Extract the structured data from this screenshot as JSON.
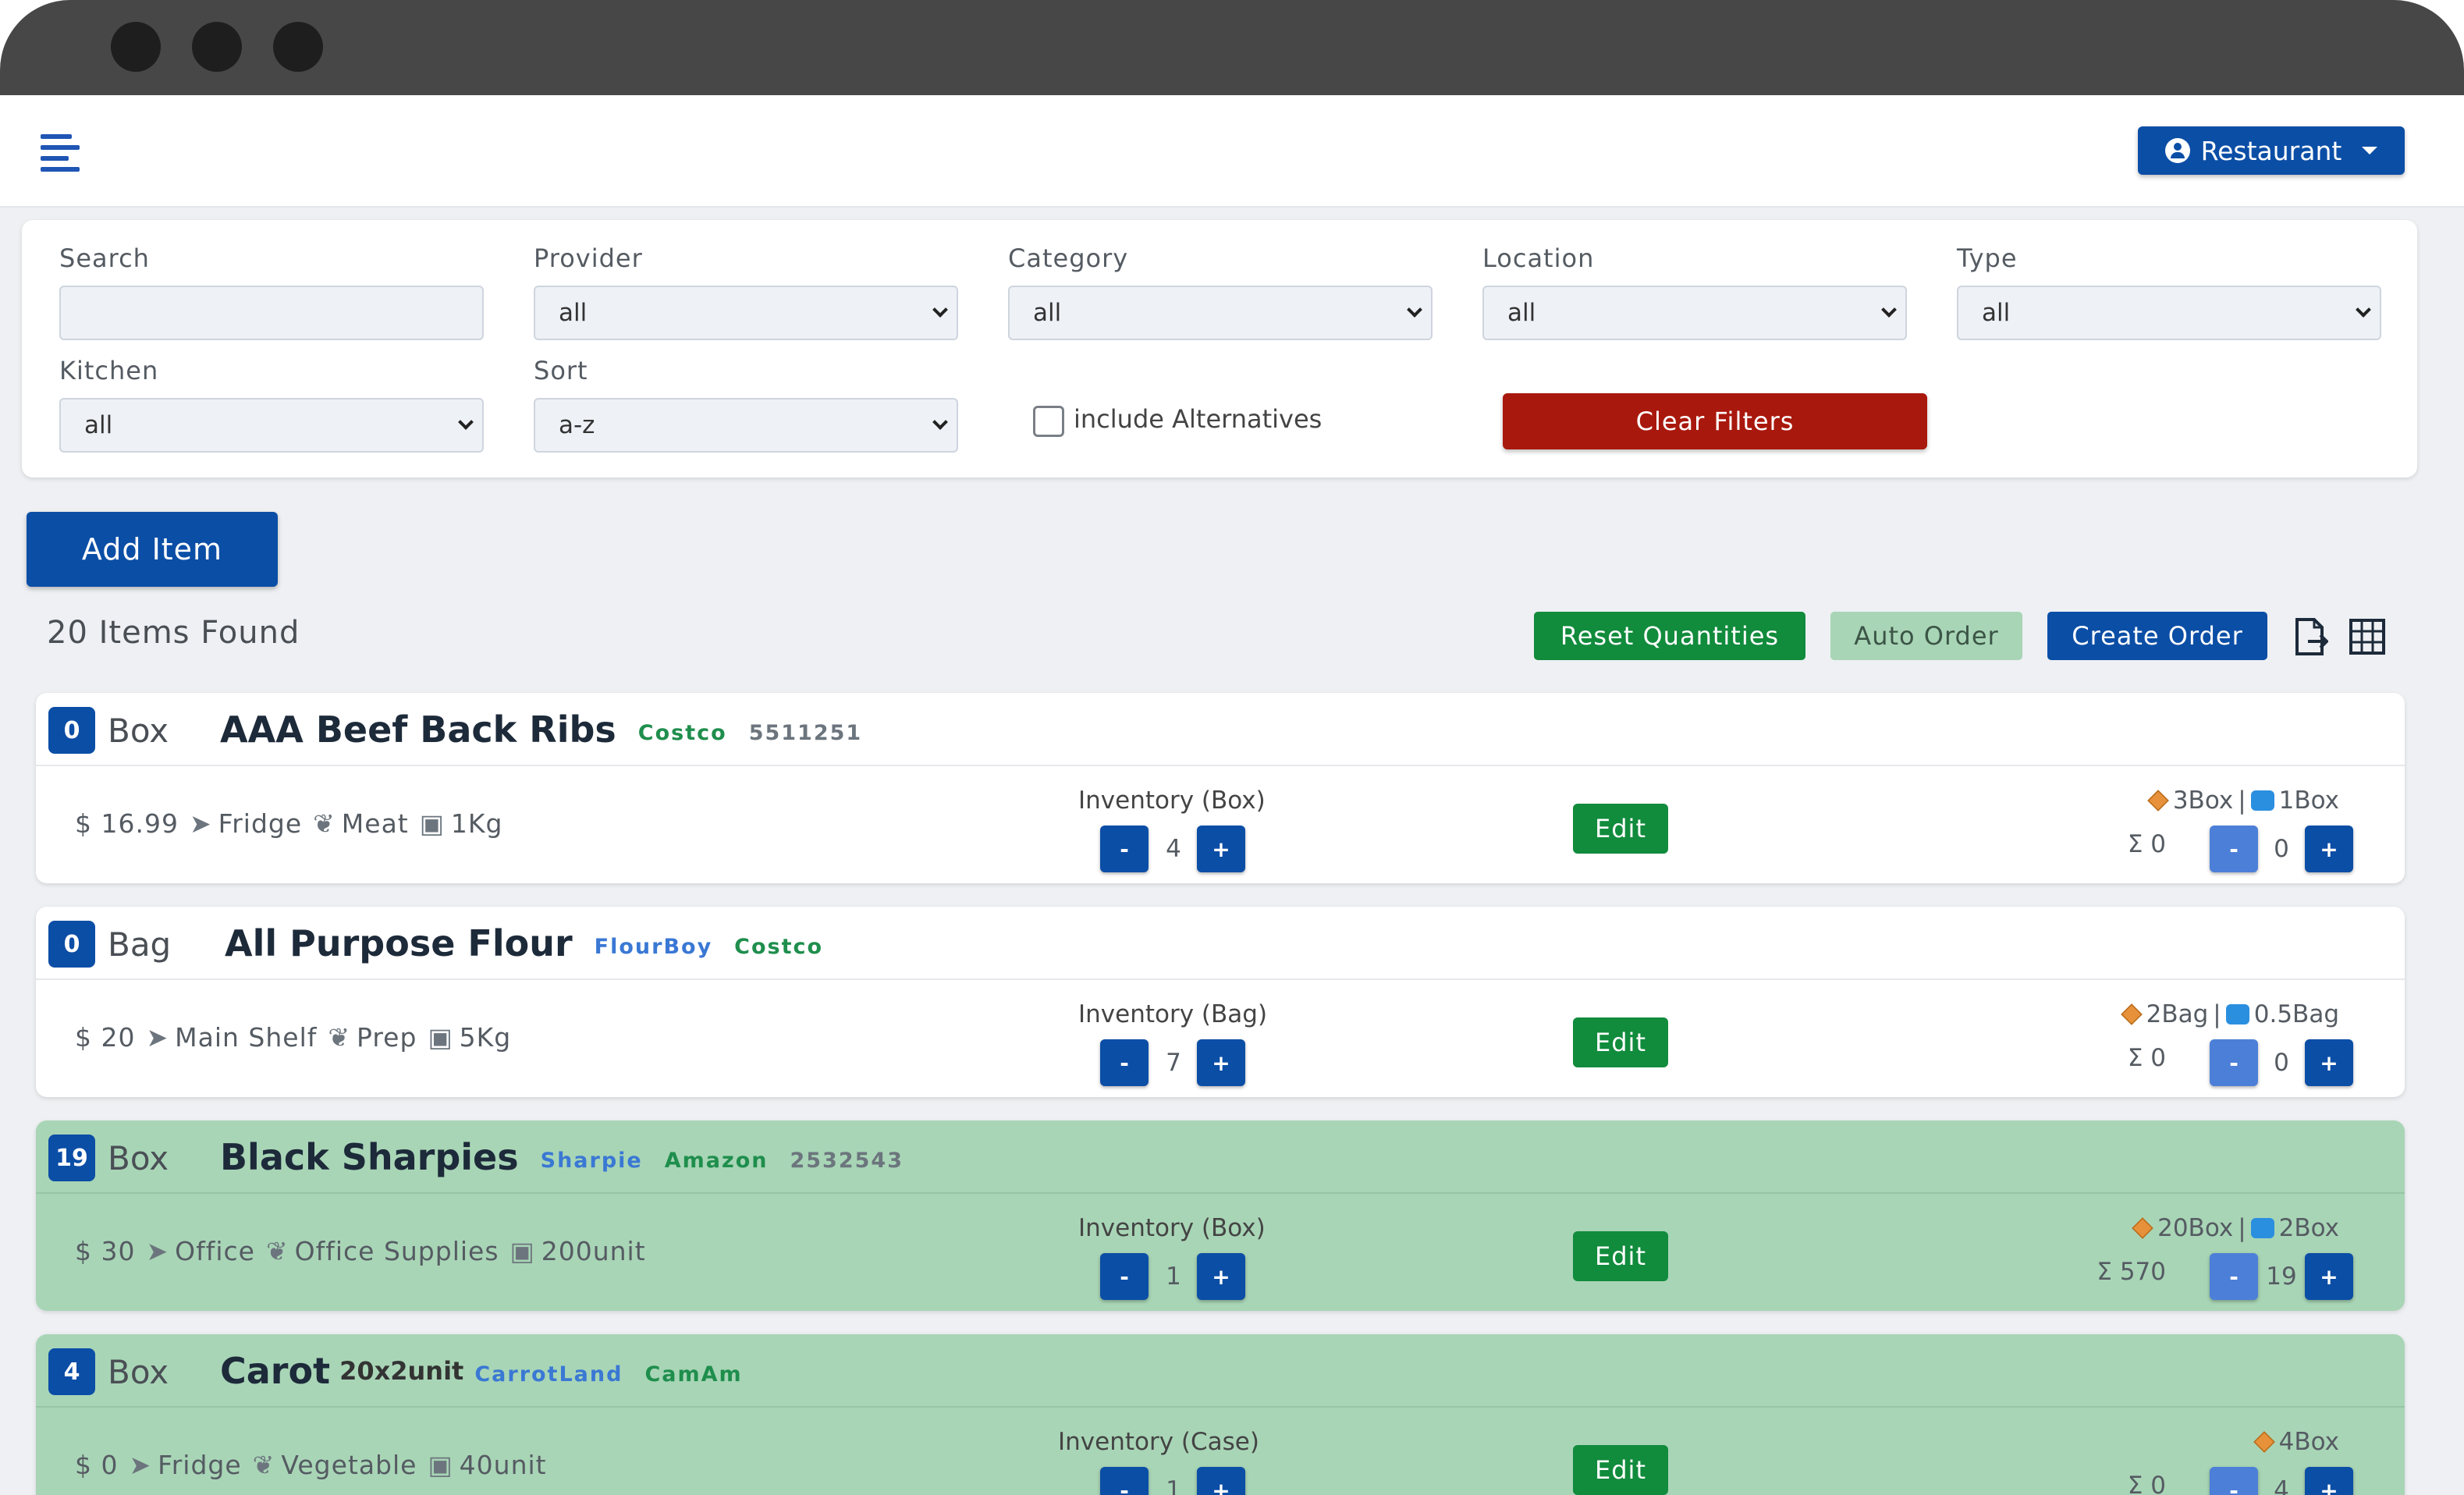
{
  "header": {
    "account_label": "Restaurant"
  },
  "filters": {
    "search_label": "Search",
    "search_value": "",
    "provider_label": "Provider",
    "provider_value": "all",
    "category_label": "Category",
    "category_value": "all",
    "location_label": "Location",
    "location_value": "all",
    "type_label": "Type",
    "type_value": "all",
    "kitchen_label": "Kitchen",
    "kitchen_value": "all",
    "sort_label": "Sort",
    "sort_value": "a-z",
    "alternatives_label": "include Alternatives",
    "alternatives_checked": false,
    "clear_label": "Clear Filters"
  },
  "actions": {
    "add_item": "Add Item",
    "items_found": "20 Items Found",
    "reset_quantities": "Reset Quantities",
    "auto_order": "Auto Order",
    "create_order": "Create Order"
  },
  "colors": {
    "primary": "#0b4ea6",
    "danger": "#a9180d",
    "success": "#118b3c",
    "highlight_row": "#a8d5b6"
  },
  "items": [
    {
      "badge": "0",
      "unit": "Box",
      "name": "AAA Beef Back Ribs",
      "size": "",
      "tags": [
        {
          "text": "Costco",
          "color": "green"
        },
        {
          "text": "5511251",
          "color": "gray"
        }
      ],
      "price": "$ 16.99",
      "location": "Fridge",
      "category": "Meat",
      "pack": "1Kg",
      "inventory_label": "Inventory (Box)",
      "inventory_qty": "4",
      "edit": "Edit",
      "par": "3Box",
      "reorder": "1Box",
      "sigma": "Σ 0",
      "order_qty": "0",
      "highlight": false
    },
    {
      "badge": "0",
      "unit": "Bag",
      "name": "All Purpose Flour",
      "size": "",
      "tags": [
        {
          "text": "FlourBoy",
          "color": "blue"
        },
        {
          "text": "Costco",
          "color": "green"
        }
      ],
      "price": "$ 20",
      "location": "Main Shelf",
      "category": "Prep",
      "pack": "5Kg",
      "inventory_label": "Inventory (Bag)",
      "inventory_qty": "7",
      "edit": "Edit",
      "par": "2Bag",
      "reorder": "0.5Bag",
      "sigma": "Σ 0",
      "order_qty": "0",
      "highlight": false
    },
    {
      "badge": "19",
      "unit": "Box",
      "name": "Black Sharpies",
      "size": "",
      "tags": [
        {
          "text": "Sharpie",
          "color": "blue"
        },
        {
          "text": "Amazon",
          "color": "green"
        },
        {
          "text": "2532543",
          "color": "gray"
        }
      ],
      "price": "$ 30",
      "location": "Office",
      "category": "Office Supplies",
      "pack": "200unit",
      "inventory_label": "Inventory (Box)",
      "inventory_qty": "1",
      "edit": "Edit",
      "par": "20Box",
      "reorder": "2Box",
      "sigma": "Σ 570",
      "order_qty": "19",
      "highlight": true
    },
    {
      "badge": "4",
      "unit": "Box",
      "name": "Carot",
      "size": "20x2unit",
      "tags": [
        {
          "text": "CarrotLand",
          "color": "blue"
        },
        {
          "text": "CamAm",
          "color": "green"
        }
      ],
      "price": "$ 0",
      "location": "Fridge",
      "category": "Vegetable",
      "pack": "40unit",
      "inventory_label": "Inventory (Case)",
      "inventory_qty": "1",
      "edit": "Edit",
      "par": "4Box",
      "reorder": "",
      "sigma": "Σ 0",
      "order_qty": "4",
      "highlight": true
    }
  ]
}
